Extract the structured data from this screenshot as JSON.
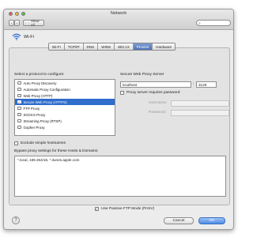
{
  "window": {
    "title": "Network"
  },
  "toolbar": {
    "show_all_label": "Show All"
  },
  "interface": {
    "name": "Wi-Fi"
  },
  "tabs": [
    {
      "label": "Wi-Fi",
      "active": false
    },
    {
      "label": "TCP/IP",
      "active": false
    },
    {
      "label": "DNS",
      "active": false
    },
    {
      "label": "WINS",
      "active": false
    },
    {
      "label": "802.1X",
      "active": false
    },
    {
      "label": "Proxies",
      "active": true
    },
    {
      "label": "Hardware",
      "active": false
    }
  ],
  "protocols": {
    "label": "Select a protocol to configure:",
    "items": [
      {
        "label": "Auto Proxy Discovery",
        "checked": false,
        "selected": false
      },
      {
        "label": "Automatic Proxy Configuration",
        "checked": false,
        "selected": false
      },
      {
        "label": "Web Proxy (HTTP)",
        "checked": false,
        "selected": false
      },
      {
        "label": "Secure Web Proxy (HTTPS)",
        "checked": true,
        "selected": true
      },
      {
        "label": "FTP Proxy",
        "checked": false,
        "selected": false
      },
      {
        "label": "SOCKS Proxy",
        "checked": false,
        "selected": false
      },
      {
        "label": "Streaming Proxy (RTSP)",
        "checked": false,
        "selected": false
      },
      {
        "label": "Gopher Proxy",
        "checked": false,
        "selected": false
      }
    ]
  },
  "server": {
    "label": "Secure Web Proxy Server",
    "host": "localhost",
    "colon": ":",
    "port": "3128",
    "password_required_label": "Proxy server requires password",
    "username_label": "Username:",
    "password_label": "Password:"
  },
  "exclude_simple_label": "Exclude simple hostnames",
  "bypass": {
    "label": "Bypass proxy settings for these Hosts & Domains:",
    "value": "*.local, 169.254/16, *.itunes.apple.com"
  },
  "passive_ftp_label": "Use Passive FTP Mode (PASV)",
  "buttons": {
    "help": "?",
    "cancel": "Cancel",
    "ok": "OK"
  },
  "colors": {
    "accent": "#2f6ccb",
    "default_button": "#4d8ce6",
    "window_bg": "#ececec"
  }
}
